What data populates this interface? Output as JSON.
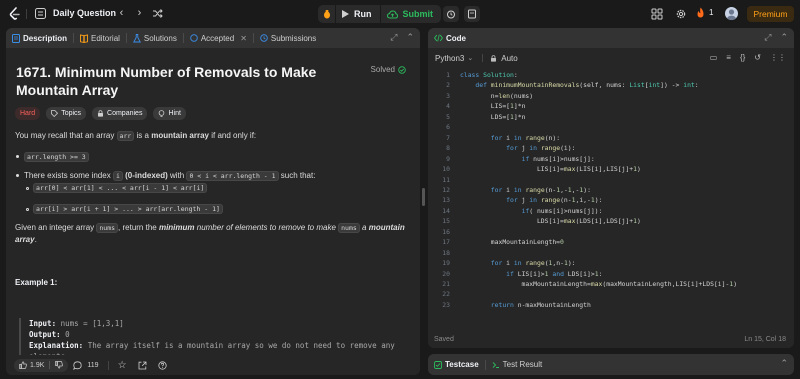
{
  "topbar": {
    "title": "Daily Question",
    "run_label": "Run",
    "submit_label": "Submit",
    "streak_count": "1",
    "premium_label": "Premium"
  },
  "left": {
    "tabs": [
      {
        "label": "Description",
        "icon": "description-icon"
      },
      {
        "label": "Editorial",
        "icon": "book-icon"
      },
      {
        "label": "Solutions",
        "icon": "flask-icon"
      },
      {
        "label": "Accepted",
        "icon": "accepted-icon"
      },
      {
        "label": "Submissions",
        "icon": "history-icon"
      }
    ],
    "title": "1671. Minimum Number of Removals to Make Mountain Array",
    "solved": "Solved",
    "tags": [
      "Hard",
      "Topics",
      "Companies",
      "Hint"
    ],
    "intro_pre": "You may recall that an array ",
    "intro_code": "arr",
    "intro_mid": " is a ",
    "intro_bold": "mountain array",
    "intro_post": " if and only if:",
    "cond1_code": "arr.length >= 3",
    "cond2_pre": "There exists some index ",
    "cond2_code1": "i",
    "cond2_bold": "(0-indexed)",
    "cond2_mid": " with ",
    "cond2_code2": "0 < i < arr.length - 1",
    "cond2_post": " such that:",
    "sub1_code": "arr[0] < arr[1] < ... < arr[i - 1] < arr[i]",
    "sub2_code": "arr[i] > arr[i + 1] > ... > arr[arr.length - 1]",
    "given_pre": "Given an integer array ",
    "given_code1": "nums",
    "given_mid1": ", return the ",
    "given_bold": "minimum",
    "given_mid2": " number of elements to remove to make ",
    "given_code2": "nums",
    "given_mid3": " a ",
    "given_bold2": "mountain array",
    "given_post": ".",
    "example_title": "Example 1:",
    "example": {
      "input_label": "Input:",
      "input": " nums = [1,3,1]",
      "output_label": "Output:",
      "output": " 0",
      "explanation_label": "Explanation:",
      "explanation": " The array itself is a mountain array so we do not need to remove any elements."
    },
    "bottom": {
      "likes": "1.9K",
      "comments": "119"
    }
  },
  "code": {
    "tab_label": "Code",
    "language": "Python3",
    "mode": "Auto",
    "status": "Saved",
    "position": "Ln 15, Col 18",
    "lines": [
      "class Solution:",
      "    def minimumMountainRemovals(self, nums: List[int]) -> int:",
      "        n=len(nums)",
      "        LIS=[1]*n",
      "        LDS=[1]*n",
      "",
      "        for i in range(n):",
      "            for j in range(i):",
      "                if nums[i]>nums[j]:",
      "                    LIS[i]=max(LIS[i],LIS[j]+1)",
      "",
      "        for i in range(n-1,-1,-1):",
      "            for j in range(n-1,i,-1):",
      "                if( nums[i]>nums[j]):",
      "                    LDS[i]=max(LDS[i],LDS[j]+1)",
      "",
      "        maxMountainLength=0",
      "",
      "        for i in range(1,n-1):",
      "            if LIS[i]>1 and LDS[i]>1:",
      "                maxMountainLength=max(maxMountainLength,LIS[i]+LDS[i]-1)",
      "",
      "        return n-maxMountainLength"
    ]
  },
  "bottom_panel": {
    "testcase_label": "Testcase",
    "result_label": "Test Result"
  },
  "colors": {
    "accent_green": "#2cbb5d",
    "hard_red": "#f8615c",
    "premium_orange": "#ffa116",
    "keyword_blue": "#569cd6",
    "function_yellow": "#dcdcaa"
  }
}
